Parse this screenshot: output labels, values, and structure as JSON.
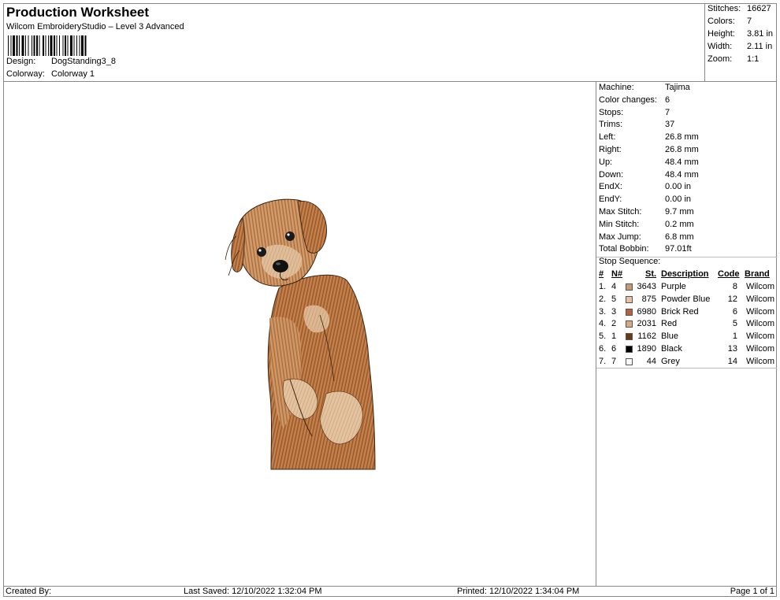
{
  "header": {
    "title": "Production Worksheet",
    "subtitle": "Wilcom EmbroideryStudio – Level 3 Advanced",
    "design_label": "Design:",
    "design_value": "DogStanding3_8",
    "colorway_label": "Colorway:",
    "colorway_value": "Colorway 1"
  },
  "summary": {
    "stitches_label": "Stitches:",
    "stitches_value": "16627",
    "colors_label": "Colors:",
    "colors_value": "7",
    "height_label": "Height:",
    "height_value": "3.81 in",
    "width_label": "Width:",
    "width_value": "2.11 in",
    "zoom_label": "Zoom:",
    "zoom_value": "1:1"
  },
  "machine_info": [
    {
      "label": "Machine:",
      "value": "Tajima"
    },
    {
      "label": "Color changes:",
      "value": "6"
    },
    {
      "label": "Stops:",
      "value": "7"
    },
    {
      "label": "Trims:",
      "value": "37"
    },
    {
      "label": "Left:",
      "value": "26.8 mm"
    },
    {
      "label": "Right:",
      "value": "26.8 mm"
    },
    {
      "label": "Up:",
      "value": "48.4 mm"
    },
    {
      "label": "Down:",
      "value": "48.4 mm"
    },
    {
      "label": "EndX:",
      "value": "0.00 in"
    },
    {
      "label": "EndY:",
      "value": "0.00 in"
    },
    {
      "label": "Max Stitch:",
      "value": "9.7 mm"
    },
    {
      "label": "Min Stitch:",
      "value": "0.2 mm"
    },
    {
      "label": "Max Jump:",
      "value": "6.8 mm"
    },
    {
      "label": "Total Bobbin:",
      "value": "97.01ft"
    }
  ],
  "stop_sequence": {
    "label": "Stop Sequence:",
    "columns": {
      "num": "#",
      "n": "N#",
      "st": "St.",
      "desc": "Description",
      "code": "Code",
      "brand": "Brand"
    },
    "rows": [
      {
        "num": "1.",
        "n": "4",
        "color": "#c99a6f",
        "st": "3643",
        "desc": "Purple",
        "code": "8",
        "brand": "Wilcom"
      },
      {
        "num": "2.",
        "n": "5",
        "color": "#e7c1a4",
        "st": "875",
        "desc": "Powder Blue",
        "code": "12",
        "brand": "Wilcom"
      },
      {
        "num": "3.",
        "n": "3",
        "color": "#b7623c",
        "st": "6980",
        "desc": "Brick Red",
        "code": "6",
        "brand": "Wilcom"
      },
      {
        "num": "4.",
        "n": "2",
        "color": "#d7a985",
        "st": "2031",
        "desc": "Red",
        "code": "5",
        "brand": "Wilcom"
      },
      {
        "num": "5.",
        "n": "1",
        "color": "#6a3a16",
        "st": "1162",
        "desc": "Blue",
        "code": "1",
        "brand": "Wilcom"
      },
      {
        "num": "6.",
        "n": "6",
        "color": "#000000",
        "st": "1890",
        "desc": "Black",
        "code": "13",
        "brand": "Wilcom"
      },
      {
        "num": "7.",
        "n": "7",
        "color": "#ffffff",
        "st": "44",
        "desc": "Grey",
        "code": "14",
        "brand": "Wilcom"
      }
    ]
  },
  "footer": {
    "created_by": "Created By:",
    "last_saved": "Last Saved: 12/10/2022 1:32:04 PM",
    "printed": "Printed: 12/10/2022 1:34:04 PM",
    "page": "Page 1 of 1"
  }
}
